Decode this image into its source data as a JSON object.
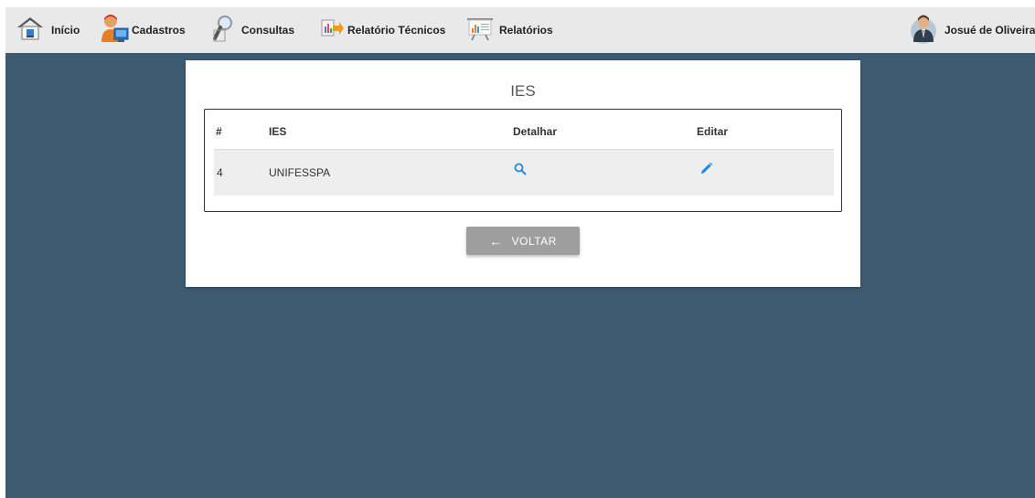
{
  "nav": {
    "items": [
      {
        "label": "Início",
        "icon": "home-icon"
      },
      {
        "label": "Cadastros",
        "icon": "user-register-icon"
      },
      {
        "label": "Consultas",
        "icon": "magnifier-icon"
      },
      {
        "label": "Relatório Técnicos",
        "icon": "report-icon"
      },
      {
        "label": "Relatórios",
        "icon": "presentation-chart-icon"
      }
    ],
    "user": {
      "name": "Josué de Oliveira",
      "icon": "user-avatar-icon"
    }
  },
  "card": {
    "title": "IES",
    "columns": [
      "#",
      "IES",
      "Detalhar",
      "Editar"
    ],
    "rows": [
      {
        "id": "4",
        "ies": "UNIFESSPA",
        "detail_icon": "search-icon",
        "edit_icon": "pencil-icon"
      }
    ],
    "back_button": "VOLTAR"
  },
  "colors": {
    "background": "#3c5a72",
    "navbar": "#e9e9e9",
    "accent": "#1e88e5",
    "button": "#9e9e9e"
  }
}
